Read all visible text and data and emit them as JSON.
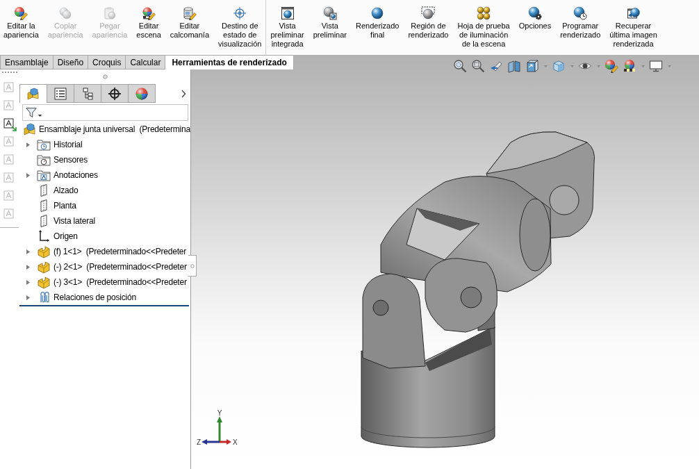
{
  "ribbon": {
    "groups": [
      {
        "buttons": [
          {
            "kind": "edit-appearance",
            "label": "Editar la\napariencia",
            "disabled": false
          },
          {
            "kind": "copy-appearance",
            "label": "Copiar\napariencia",
            "disabled": true
          },
          {
            "kind": "paste-appearance",
            "label": "Pegar\napariencia",
            "disabled": true
          },
          {
            "kind": "edit-scene",
            "label": "Editar\nescena",
            "disabled": false
          },
          {
            "kind": "edit-decal",
            "label": "Editar\ncalcomanía",
            "disabled": false
          },
          {
            "kind": "display-state",
            "label": "Destino de\nestado de\nvisualización",
            "disabled": false
          }
        ]
      },
      {
        "buttons": [
          {
            "kind": "integrated-preview",
            "label": "Vista\npreliminar\nintegrada",
            "disabled": false
          },
          {
            "kind": "preview-window",
            "label": "Vista\npreliminar",
            "disabled": false
          },
          {
            "kind": "final-render",
            "label": "Renderizado\nfinal",
            "disabled": false
          },
          {
            "kind": "render-region",
            "label": "Región de\nrenderizado",
            "disabled": false
          },
          {
            "kind": "proof-sheet",
            "label": "Hoja de prueba\nde iluminación\nde la escena",
            "disabled": false
          },
          {
            "kind": "options",
            "label": "Opciones",
            "disabled": false
          },
          {
            "kind": "schedule",
            "label": "Programar\nrenderizado",
            "disabled": false
          },
          {
            "kind": "recall",
            "label": "Recuperar\núltima imagen\nrenderizada",
            "disabled": false
          }
        ]
      }
    ]
  },
  "command_tabs": [
    {
      "label": "Ensamblaje",
      "selected": false
    },
    {
      "label": "Diseño",
      "selected": false
    },
    {
      "label": "Croquis",
      "selected": false
    },
    {
      "label": "Calcular",
      "selected": false
    },
    {
      "label": "Herramientas de renderizado",
      "selected": true
    }
  ],
  "side_toolbar": [
    {
      "disabled": true
    },
    {
      "disabled": true
    },
    {
      "disabled": false
    },
    {
      "disabled": true
    },
    {
      "disabled": true
    },
    {
      "disabled": true
    },
    {
      "disabled": true
    },
    {
      "disabled": true
    }
  ],
  "panel_tabs": [
    {
      "kind": "feature-tree",
      "selected": true
    },
    {
      "kind": "properties",
      "selected": false
    },
    {
      "kind": "configurations",
      "selected": false
    },
    {
      "kind": "dimxpert",
      "selected": false
    },
    {
      "kind": "display",
      "selected": false
    }
  ],
  "tree": {
    "root": {
      "label": "Ensamblaje junta universal  (Predetermina",
      "children": [
        {
          "kind": "history",
          "label": "Historial",
          "expandable": true,
          "hovered": false
        },
        {
          "kind": "sensors",
          "label": "Sensores",
          "expandable": false,
          "hovered": false
        },
        {
          "kind": "annotations",
          "label": "Anotaciones",
          "expandable": true,
          "hovered": false
        },
        {
          "kind": "plane",
          "label": "Alzado",
          "expandable": false,
          "hovered": false
        },
        {
          "kind": "plane",
          "label": "Planta",
          "expandable": false,
          "hovered": false
        },
        {
          "kind": "plane",
          "label": "Vista lateral",
          "expandable": false,
          "hovered": false
        },
        {
          "kind": "origin",
          "label": "Origen",
          "expandable": false,
          "hovered": false
        },
        {
          "kind": "part",
          "label": "(f) 1<1>  (Predeterminado<<Predeter",
          "expandable": true,
          "hovered": false
        },
        {
          "kind": "part",
          "label": "(-) 2<1>  (Predeterminado<<Predeter",
          "expandable": true,
          "hovered": true
        },
        {
          "kind": "part",
          "label": "(-) 3<1>  (Predeterminado<<Predeter",
          "expandable": true,
          "hovered": false
        },
        {
          "kind": "mates",
          "label": "Relaciones de posición",
          "expandable": true,
          "hovered": false
        }
      ]
    }
  },
  "heads_up_toolbar": [
    {
      "kind": "zoom-fit",
      "dropdown": false
    },
    {
      "kind": "zoom-area",
      "dropdown": false
    },
    {
      "kind": "previous-view",
      "dropdown": false
    },
    {
      "kind": "section-view",
      "dropdown": false
    },
    {
      "kind": "view-orientation",
      "dropdown": true
    },
    {
      "kind": "display-style",
      "dropdown": true
    },
    {
      "kind": "hide-show",
      "dropdown": true
    },
    {
      "kind": "edit-appearance",
      "dropdown": false
    },
    {
      "kind": "apply-scene",
      "dropdown": true
    },
    {
      "kind": "view-settings",
      "dropdown": true
    }
  ],
  "triad": {
    "x": "X",
    "y": "Y",
    "z": "Z"
  }
}
